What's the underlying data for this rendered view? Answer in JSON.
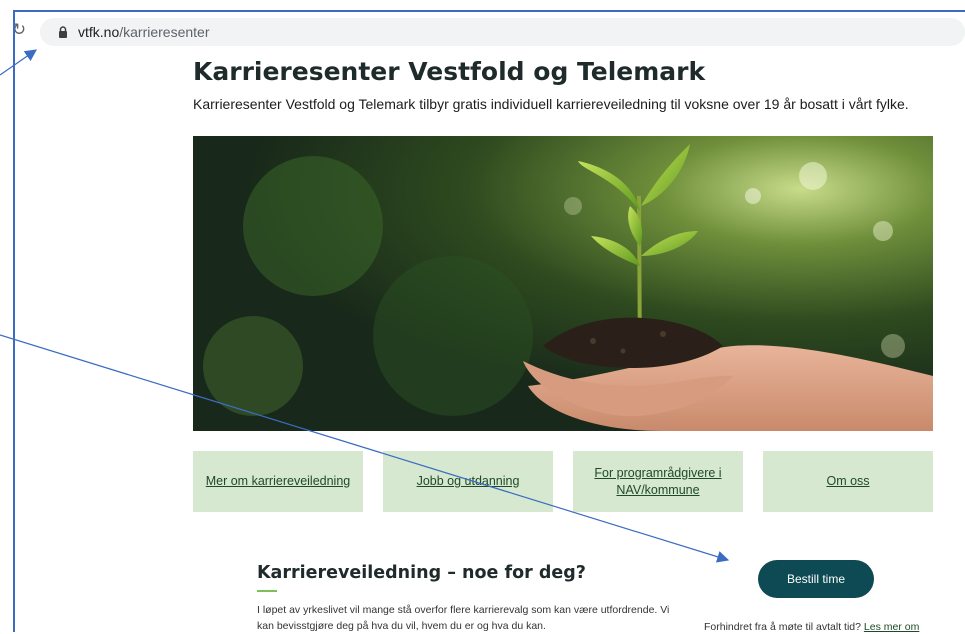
{
  "browser": {
    "domain": "vtfk.no",
    "path": "/karrieresenter",
    "reload_icon": "reload-icon",
    "lock_icon": "lock-icon"
  },
  "page": {
    "title": "Karrieresenter Vestfold og Telemark",
    "intro": "Karrieresenter Vestfold og Telemark tilbyr gratis individuell karriereveiledning til voksne over 19 år bosatt i vårt fylke."
  },
  "quick_links": [
    {
      "label": "Mer om karriereveiledning"
    },
    {
      "label": "Jobb og utdanning"
    },
    {
      "label": "For programrådgivere i NAV/kommune"
    },
    {
      "label": "Om oss"
    }
  ],
  "section": {
    "title": "Karriereveiledning – noe for deg?",
    "text": "I løpet av yrkeslivet vil mange stå overfor flere karrierevalg som kan være utfordrende. Vi kan bevisstgjøre deg på hva du vil, hvem du er og hva du kan."
  },
  "cta": {
    "label": "Bestill time",
    "note_prefix": "Forhindret fra å møte til avtalt tid?",
    "note_link": "Les mer om"
  },
  "colors": {
    "link_tile_bg": "#d6e8cf",
    "cta_bg": "#0d4a53",
    "annotation_blue": "#3b6cc2",
    "accent_green": "#7fbf5b"
  }
}
